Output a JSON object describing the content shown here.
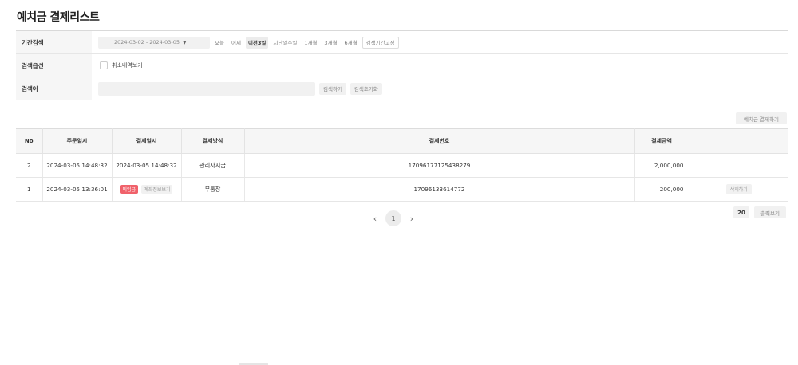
{
  "page": {
    "title": "예치금 결제리스트"
  },
  "search": {
    "period_label": "기간검색",
    "date_range": "2024-03-02 - 2024-03-05",
    "period_buttons": [
      "오늘",
      "어제",
      "이전3일",
      "지난일주일",
      "1개월",
      "3개월",
      "6개월"
    ],
    "active_period": "이전3일",
    "fix_period_label": "검색기간고정",
    "option_label": "검색옵션",
    "show_cancelled_label": "취소내역보기",
    "keyword_label": "검색어",
    "keyword_value": "",
    "search_button": "검색하기",
    "reset_button": "검색초기화"
  },
  "actions": {
    "pay_deposit": "예치금 결제하기"
  },
  "table": {
    "columns": [
      "No",
      "주문일시",
      "결제일시",
      "결제방식",
      "결제번호",
      "결제금액",
      ""
    ],
    "rows": [
      {
        "no": "2",
        "order_time": "2024-03-05 14:48:32",
        "pay_time": "2024-03-05 14:48:32",
        "method": "관리자지급",
        "pay_no": "17096177125438279",
        "amount": "2,000,000",
        "badge": "",
        "info_button": "",
        "delete_button": ""
      },
      {
        "no": "1",
        "order_time": "2024-03-05 13:36:01",
        "pay_time": "",
        "method": "무통장",
        "pay_no": "17096133614772",
        "amount": "200,000",
        "badge": "미입금",
        "info_button": "계좌정보보기",
        "delete_button": "삭제하기"
      }
    ]
  },
  "pagination": {
    "prev": "‹",
    "current": "1",
    "next": "›"
  },
  "footer": {
    "page_size": "20",
    "view_output": "출력보기"
  },
  "colors": {
    "badge_red": "#f0616a",
    "header_bg": "#f6f6f6"
  }
}
